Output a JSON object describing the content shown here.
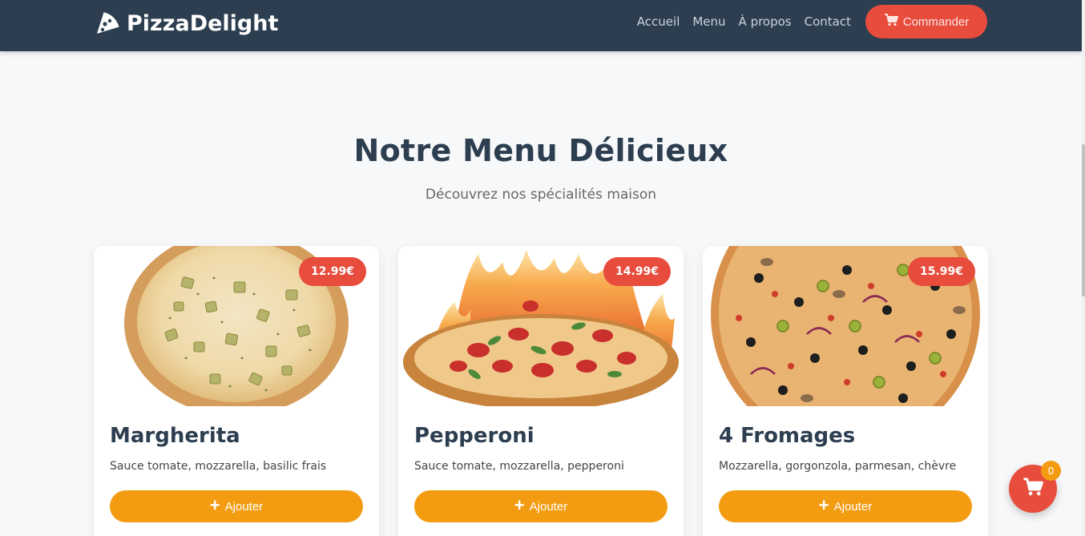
{
  "header": {
    "brand": "PizzaDelight",
    "nav": [
      "Accueil",
      "Menu",
      "À propos",
      "Contact"
    ],
    "order_label": "Commander"
  },
  "menu": {
    "title": "Notre Menu Délicieux",
    "subtitle": "Découvrez nos spécialités maison",
    "add_label": "Ajouter",
    "items": [
      {
        "name": "Margherita",
        "description": "Sauce tomate, mozzarella, basilic frais",
        "price": "12.99€"
      },
      {
        "name": "Pepperoni",
        "description": "Sauce tomate, mozzarella, pepperoni",
        "price": "14.99€"
      },
      {
        "name": "4 Fromages",
        "description": "Mozzarella, gorgonzola, parmesan, chèvre",
        "price": "15.99€"
      }
    ]
  },
  "cart": {
    "count": "0"
  },
  "icons": {
    "brand": "pizza-slice-icon",
    "cart": "cart-icon",
    "add": "plus-icon"
  },
  "colors": {
    "nav": "#2c3e50",
    "accent": "#e74c3c",
    "add_button": "#f39c12",
    "background": "#f7f8fa"
  }
}
